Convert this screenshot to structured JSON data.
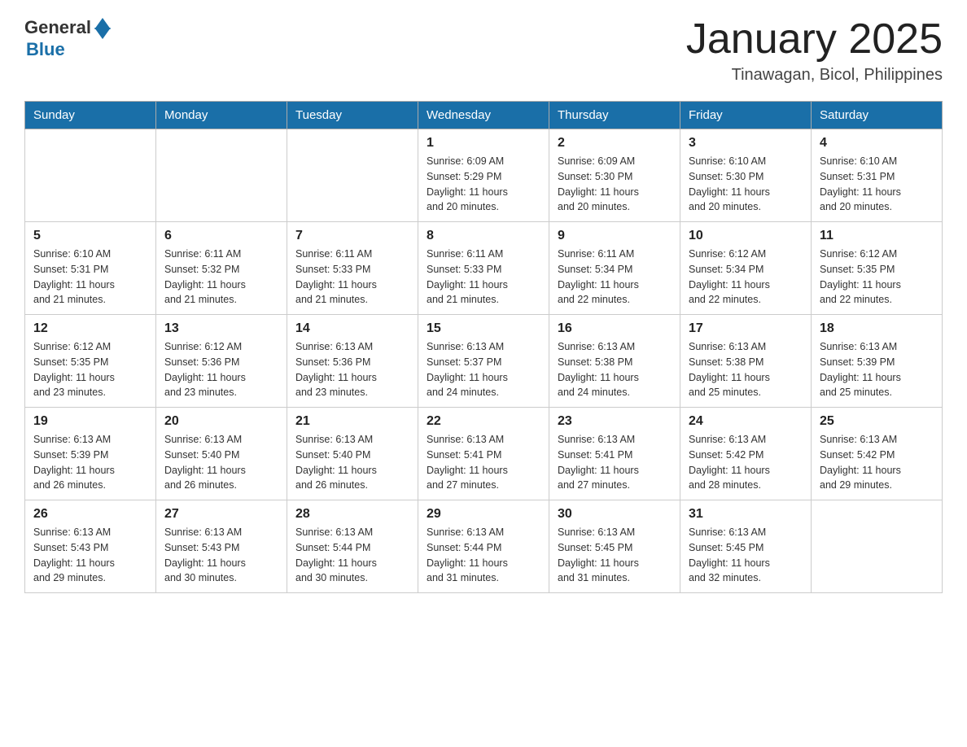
{
  "header": {
    "logo_general": "General",
    "logo_blue": "Blue",
    "title": "January 2025",
    "location": "Tinawagan, Bicol, Philippines"
  },
  "days_of_week": [
    "Sunday",
    "Monday",
    "Tuesday",
    "Wednesday",
    "Thursday",
    "Friday",
    "Saturday"
  ],
  "weeks": [
    [
      {
        "day": "",
        "info": ""
      },
      {
        "day": "",
        "info": ""
      },
      {
        "day": "",
        "info": ""
      },
      {
        "day": "1",
        "info": "Sunrise: 6:09 AM\nSunset: 5:29 PM\nDaylight: 11 hours\nand 20 minutes."
      },
      {
        "day": "2",
        "info": "Sunrise: 6:09 AM\nSunset: 5:30 PM\nDaylight: 11 hours\nand 20 minutes."
      },
      {
        "day": "3",
        "info": "Sunrise: 6:10 AM\nSunset: 5:30 PM\nDaylight: 11 hours\nand 20 minutes."
      },
      {
        "day": "4",
        "info": "Sunrise: 6:10 AM\nSunset: 5:31 PM\nDaylight: 11 hours\nand 20 minutes."
      }
    ],
    [
      {
        "day": "5",
        "info": "Sunrise: 6:10 AM\nSunset: 5:31 PM\nDaylight: 11 hours\nand 21 minutes."
      },
      {
        "day": "6",
        "info": "Sunrise: 6:11 AM\nSunset: 5:32 PM\nDaylight: 11 hours\nand 21 minutes."
      },
      {
        "day": "7",
        "info": "Sunrise: 6:11 AM\nSunset: 5:33 PM\nDaylight: 11 hours\nand 21 minutes."
      },
      {
        "day": "8",
        "info": "Sunrise: 6:11 AM\nSunset: 5:33 PM\nDaylight: 11 hours\nand 21 minutes."
      },
      {
        "day": "9",
        "info": "Sunrise: 6:11 AM\nSunset: 5:34 PM\nDaylight: 11 hours\nand 22 minutes."
      },
      {
        "day": "10",
        "info": "Sunrise: 6:12 AM\nSunset: 5:34 PM\nDaylight: 11 hours\nand 22 minutes."
      },
      {
        "day": "11",
        "info": "Sunrise: 6:12 AM\nSunset: 5:35 PM\nDaylight: 11 hours\nand 22 minutes."
      }
    ],
    [
      {
        "day": "12",
        "info": "Sunrise: 6:12 AM\nSunset: 5:35 PM\nDaylight: 11 hours\nand 23 minutes."
      },
      {
        "day": "13",
        "info": "Sunrise: 6:12 AM\nSunset: 5:36 PM\nDaylight: 11 hours\nand 23 minutes."
      },
      {
        "day": "14",
        "info": "Sunrise: 6:13 AM\nSunset: 5:36 PM\nDaylight: 11 hours\nand 23 minutes."
      },
      {
        "day": "15",
        "info": "Sunrise: 6:13 AM\nSunset: 5:37 PM\nDaylight: 11 hours\nand 24 minutes."
      },
      {
        "day": "16",
        "info": "Sunrise: 6:13 AM\nSunset: 5:38 PM\nDaylight: 11 hours\nand 24 minutes."
      },
      {
        "day": "17",
        "info": "Sunrise: 6:13 AM\nSunset: 5:38 PM\nDaylight: 11 hours\nand 25 minutes."
      },
      {
        "day": "18",
        "info": "Sunrise: 6:13 AM\nSunset: 5:39 PM\nDaylight: 11 hours\nand 25 minutes."
      }
    ],
    [
      {
        "day": "19",
        "info": "Sunrise: 6:13 AM\nSunset: 5:39 PM\nDaylight: 11 hours\nand 26 minutes."
      },
      {
        "day": "20",
        "info": "Sunrise: 6:13 AM\nSunset: 5:40 PM\nDaylight: 11 hours\nand 26 minutes."
      },
      {
        "day": "21",
        "info": "Sunrise: 6:13 AM\nSunset: 5:40 PM\nDaylight: 11 hours\nand 26 minutes."
      },
      {
        "day": "22",
        "info": "Sunrise: 6:13 AM\nSunset: 5:41 PM\nDaylight: 11 hours\nand 27 minutes."
      },
      {
        "day": "23",
        "info": "Sunrise: 6:13 AM\nSunset: 5:41 PM\nDaylight: 11 hours\nand 27 minutes."
      },
      {
        "day": "24",
        "info": "Sunrise: 6:13 AM\nSunset: 5:42 PM\nDaylight: 11 hours\nand 28 minutes."
      },
      {
        "day": "25",
        "info": "Sunrise: 6:13 AM\nSunset: 5:42 PM\nDaylight: 11 hours\nand 29 minutes."
      }
    ],
    [
      {
        "day": "26",
        "info": "Sunrise: 6:13 AM\nSunset: 5:43 PM\nDaylight: 11 hours\nand 29 minutes."
      },
      {
        "day": "27",
        "info": "Sunrise: 6:13 AM\nSunset: 5:43 PM\nDaylight: 11 hours\nand 30 minutes."
      },
      {
        "day": "28",
        "info": "Sunrise: 6:13 AM\nSunset: 5:44 PM\nDaylight: 11 hours\nand 30 minutes."
      },
      {
        "day": "29",
        "info": "Sunrise: 6:13 AM\nSunset: 5:44 PM\nDaylight: 11 hours\nand 31 minutes."
      },
      {
        "day": "30",
        "info": "Sunrise: 6:13 AM\nSunset: 5:45 PM\nDaylight: 11 hours\nand 31 minutes."
      },
      {
        "day": "31",
        "info": "Sunrise: 6:13 AM\nSunset: 5:45 PM\nDaylight: 11 hours\nand 32 minutes."
      },
      {
        "day": "",
        "info": ""
      }
    ]
  ]
}
